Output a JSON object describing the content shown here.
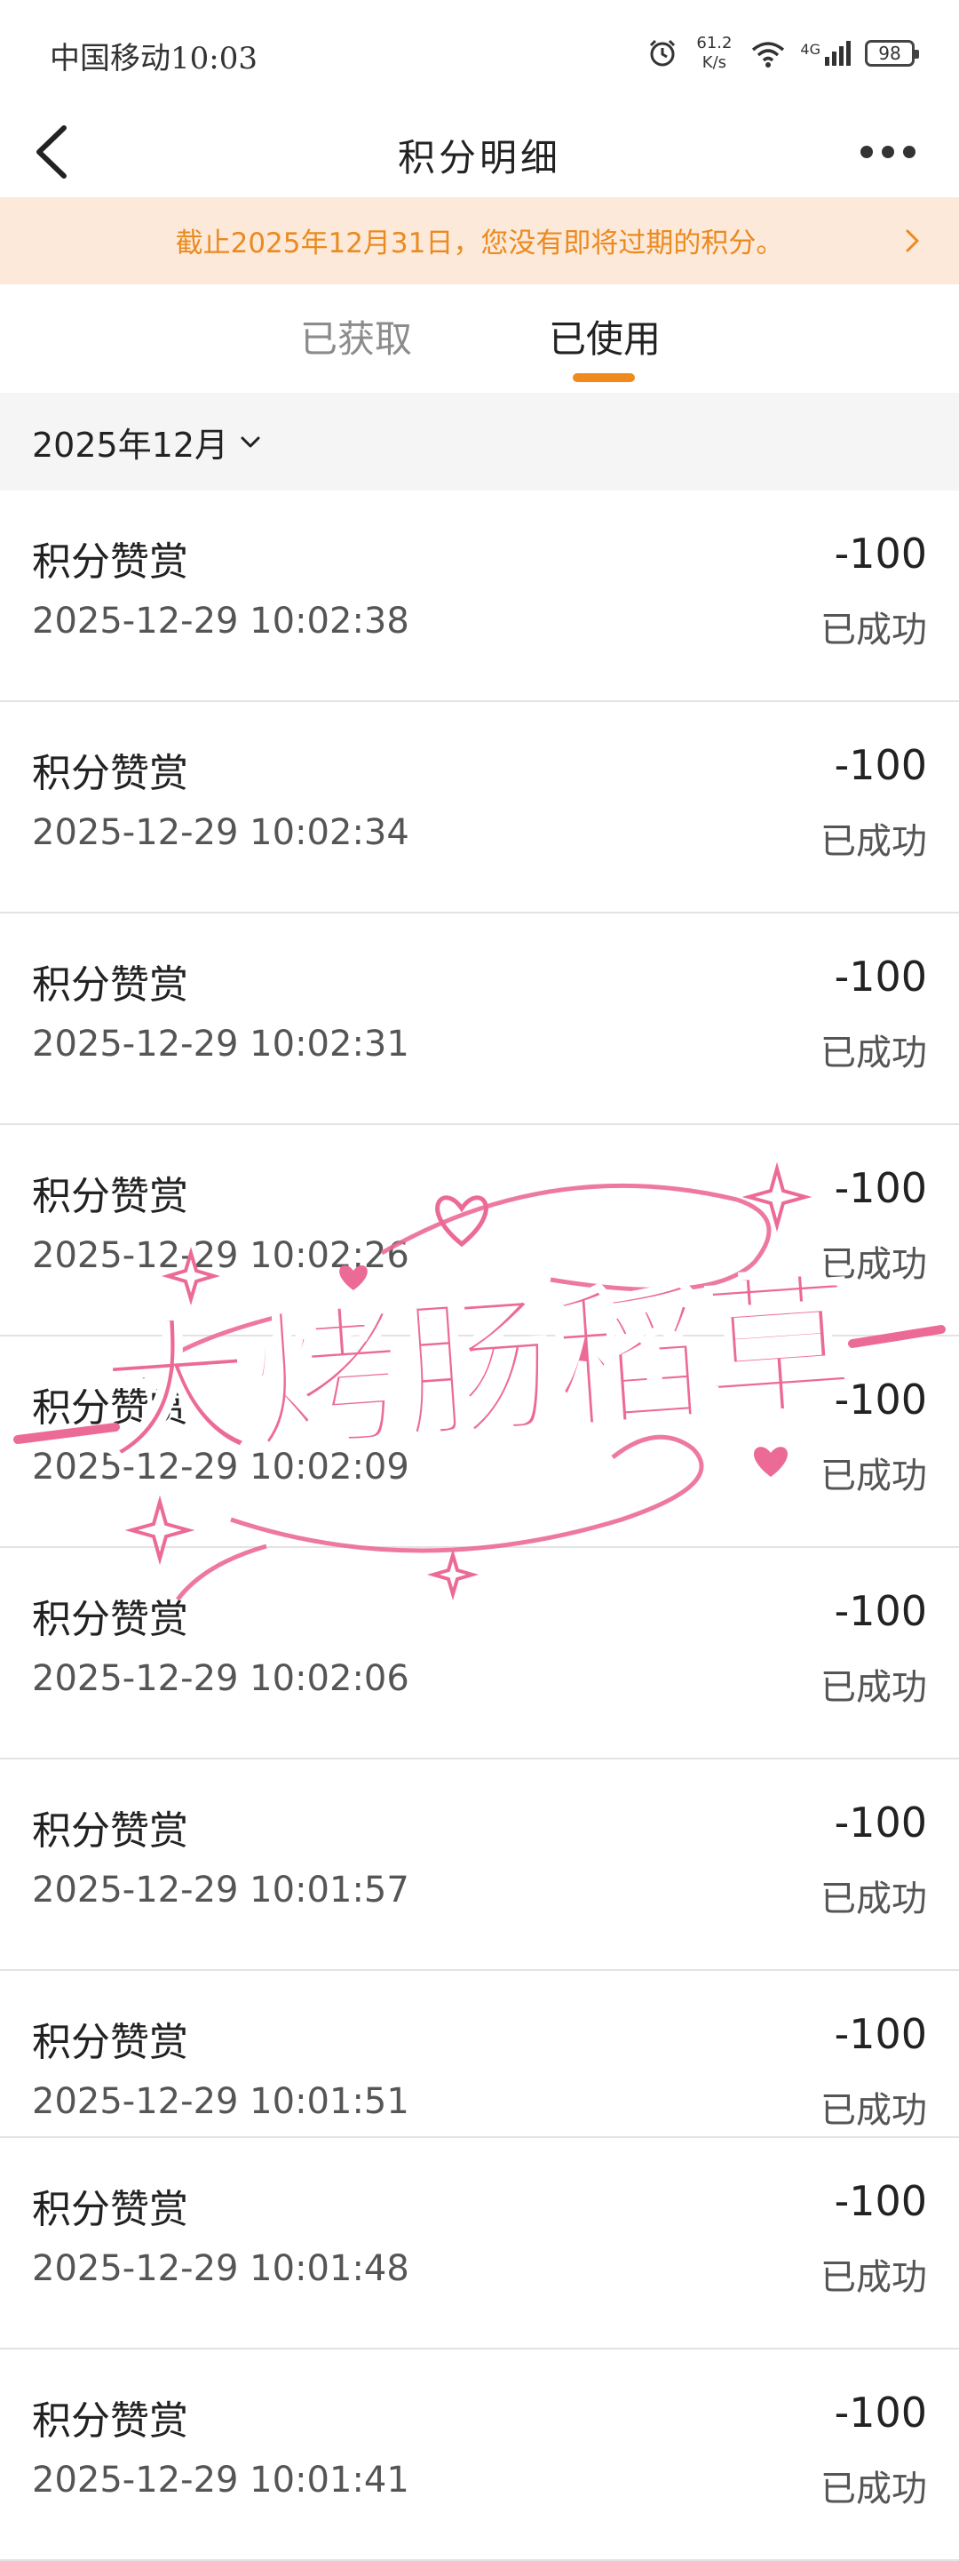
{
  "status_bar": {
    "carrier_time": "中国移动10:03",
    "net_speed": "61.2",
    "net_unit": "K/s",
    "signal": "4G",
    "battery": "98"
  },
  "header": {
    "title": "积分明细"
  },
  "notice": {
    "text": "截止2025年12月31日，您没有即将过期的积分。"
  },
  "tabs": [
    {
      "label": "已获取"
    },
    {
      "label": "已使用"
    }
  ],
  "active_tab": "已使用",
  "month_filter": {
    "label": "2025年12月"
  },
  "records": [
    {
      "title": "积分赞赏",
      "amount": "-100",
      "time": "2025-12-29 10:02:38",
      "status": "已成功"
    },
    {
      "title": "积分赞赏",
      "amount": "-100",
      "time": "2025-12-29 10:02:34",
      "status": "已成功"
    },
    {
      "title": "积分赞赏",
      "amount": "-100",
      "time": "2025-12-29 10:02:31",
      "status": "已成功"
    },
    {
      "title": "积分赞赏",
      "amount": "-100",
      "time": "2025-12-29 10:02:26",
      "status": "已成功"
    },
    {
      "title": "积分赞赏",
      "amount": "-100",
      "time": "2025-12-29 10:02:09",
      "status": "已成功"
    },
    {
      "title": "积分赞赏",
      "amount": "-100",
      "time": "2025-12-29 10:02:06",
      "status": "已成功"
    },
    {
      "title": "积分赞赏",
      "amount": "-100",
      "time": "2025-12-29 10:01:57",
      "status": "已成功"
    },
    {
      "title": "积分赞赏",
      "amount": "-100",
      "time": "2025-12-29 10:01:51",
      "status": "已成功"
    },
    {
      "title": "积分赞赏",
      "amount": "-100",
      "time": "2025-12-29 10:01:48",
      "status": "已成功"
    },
    {
      "title": "积分赞赏",
      "amount": "-100",
      "time": "2025-12-29 10:01:41",
      "status": "已成功"
    }
  ],
  "watermark": {
    "text": "大烤肠稻草",
    "color": "#ec6a96"
  },
  "colors": {
    "accent": "#f08a1c",
    "notice_bg": "#fde9d9",
    "notice_text": "#ea8a1f"
  }
}
